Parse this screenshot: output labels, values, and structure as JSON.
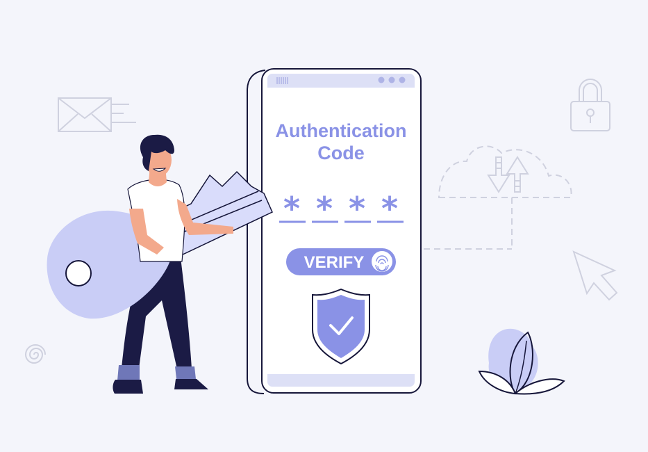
{
  "phone": {
    "title_line1": "Authentication",
    "title_line2": "Code",
    "code_mask": [
      "*",
      "*",
      "*",
      "*"
    ],
    "verify_label": "VERIFY"
  },
  "colors": {
    "background": "#f4f5fb",
    "accent": "#8a92e6",
    "accent_light": "#c9cdf6",
    "ink": "#16163a",
    "outline": "#d0d2e0"
  },
  "icons": [
    "envelope-icon",
    "lock-icon",
    "cloud-upload-icon",
    "cursor-arrow-icon",
    "shield-check-icon",
    "fingerprint-icon",
    "spiral-icon",
    "plant-illustration",
    "key-illustration",
    "person-illustration"
  ]
}
